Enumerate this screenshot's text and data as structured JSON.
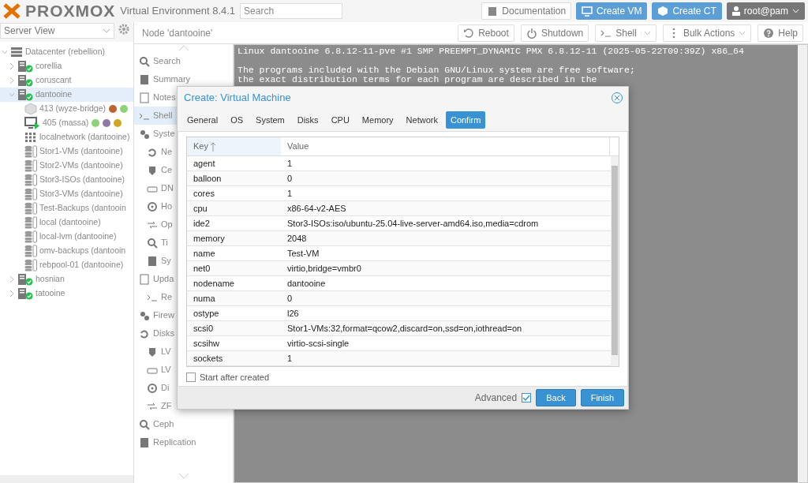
{
  "topbar": {
    "product": "PROXMOX",
    "version": "Virtual Environment 8.4.1",
    "search": {
      "placeholder": "Search"
    },
    "buttons": [
      {
        "label": "Documentation",
        "kind": "plain"
      },
      {
        "label": "Create VM",
        "kind": "primary"
      },
      {
        "label": "Create CT",
        "kind": "primary"
      }
    ],
    "user": "root@pam"
  },
  "sidebar": {
    "view": "Server View",
    "tree": [
      {
        "label": "Datacenter (rebellion)",
        "kind": "datacenter",
        "expanded": true,
        "selected": false,
        "children": [
          {
            "label": "corellia",
            "kind": "node",
            "expanded": false,
            "selected": false
          },
          {
            "label": "coruscant",
            "kind": "node",
            "expanded": false,
            "selected": false
          },
          {
            "label": "dantooine",
            "kind": "node",
            "expanded": true,
            "selected": true,
            "children": [
              {
                "label": "413 (wyze-bridge)",
                "kind": "ct",
                "selected": false,
                "tags": [
                  {
                    "color": "#c0622f"
                  },
                  {
                    "color": "#8fd378"
                  }
                ]
              },
              {
                "label": "405 (massa)",
                "kind": "vm",
                "selected": false,
                "tags": [
                  {
                    "color": "#8fd378"
                  },
                  {
                    "color": "#8f78a6"
                  },
                  {
                    "color": "#d3a622"
                  }
                ]
              },
              {
                "label": "localnetwork (dantooine)",
                "kind": "sdn",
                "selected": false
              },
              {
                "label": "Stor1-VMs (dantooine)",
                "kind": "storage",
                "selected": false
              },
              {
                "label": "Stor2-VMs (dantooine)",
                "kind": "storage",
                "selected": false
              },
              {
                "label": "Stor3-ISOs (dantooine)",
                "kind": "storage",
                "selected": false
              },
              {
                "label": "Stor3-VMs (dantooine)",
                "kind": "storage",
                "selected": false
              },
              {
                "label": "Test-Backups (dantooin",
                "kind": "storage",
                "selected": false
              },
              {
                "label": "local (dantooine)",
                "kind": "storage",
                "selected": false
              },
              {
                "label": "local-lvm (dantooine)",
                "kind": "storage",
                "selected": false
              },
              {
                "label": "omv-backups (dantooin",
                "kind": "storage",
                "selected": false
              },
              {
                "label": "rebpool-01 (dantooine)",
                "kind": "storage",
                "selected": false
              }
            ]
          },
          {
            "label": "hosnian",
            "kind": "node",
            "expanded": false,
            "selected": false
          },
          {
            "label": "tatooine",
            "kind": "node",
            "expanded": false,
            "selected": false
          }
        ]
      }
    ]
  },
  "node_panel": {
    "title": "Node 'dantooine'",
    "toolbar": [
      {
        "label": "Reboot",
        "kind": "plain"
      },
      {
        "label": "Shutdown",
        "kind": "plain"
      },
      {
        "label": "Shell",
        "kind": "split"
      },
      {
        "label": "Bulk Actions",
        "kind": "menu"
      },
      {
        "label": "Help",
        "kind": "plain"
      }
    ],
    "nav": [
      {
        "label": "Search",
        "selected": false
      },
      {
        "label": "Summary",
        "selected": false
      },
      {
        "label": "Notes",
        "selected": false
      },
      {
        "label": "Shell",
        "selected": true
      },
      {
        "label": "Syste",
        "selected": false,
        "children": [
          {
            "label": "Ne",
            "selected": false
          },
          {
            "label": "Ce",
            "selected": false
          },
          {
            "label": "DN",
            "selected": false
          },
          {
            "label": "Ho",
            "selected": false
          },
          {
            "label": "Op",
            "selected": false
          },
          {
            "label": "Ti",
            "selected": false
          },
          {
            "label": "Sy",
            "selected": false
          }
        ]
      },
      {
        "label": "Upda",
        "selected": false,
        "children": [
          {
            "label": "Re",
            "selected": false
          }
        ]
      },
      {
        "label": "Firew",
        "selected": false
      },
      {
        "label": "Disks",
        "selected": false,
        "children": [
          {
            "label": "LV",
            "selected": false
          },
          {
            "label": "LV",
            "selected": false
          },
          {
            "label": "Di",
            "selected": false
          },
          {
            "label": "ZF",
            "selected": false
          }
        ]
      },
      {
        "label": "Ceph",
        "selected": false
      },
      {
        "label": "Replication",
        "selected": false
      }
    ],
    "terminal": {
      "blocks": [
        [
          "Linux dantooine 6.8.12-11-pve #1 SMP PREEMPT_DYNAMIC PMX 6.8.12-11 (2025-05-22T09:39Z) x86_64"
        ],
        [
          "The programs included with the Debian GNU/Linux system are free software;",
          "the exact distribution terms for each program are described in the"
        ]
      ]
    }
  },
  "dialog": {
    "title": "Create: Virtual Machine",
    "tabs": [
      {
        "label": "General",
        "selected": false
      },
      {
        "label": "OS",
        "selected": false
      },
      {
        "label": "System",
        "selected": false
      },
      {
        "label": "Disks",
        "selected": false
      },
      {
        "label": "CPU",
        "selected": false
      },
      {
        "label": "Memory",
        "selected": false
      },
      {
        "label": "Network",
        "selected": false
      },
      {
        "label": "Confirm",
        "selected": true
      }
    ],
    "columns": [
      {
        "label": "Key",
        "sorted": true
      },
      {
        "label": "Value",
        "sorted": false
      }
    ],
    "rows": [
      {
        "key": "agent",
        "value": "1"
      },
      {
        "key": "balloon",
        "value": "0"
      },
      {
        "key": "cores",
        "value": "1"
      },
      {
        "key": "cpu",
        "value": "x86-64-v2-AES"
      },
      {
        "key": "ide2",
        "value": "Stor3-ISOs:iso/ubuntu-25.04-live-server-amd64.iso,media=cdrom"
      },
      {
        "key": "memory",
        "value": "2048"
      },
      {
        "key": "name",
        "value": "Test-VM"
      },
      {
        "key": "net0",
        "value": "virtio,bridge=vmbr0"
      },
      {
        "key": "nodename",
        "value": "dantooine"
      },
      {
        "key": "numa",
        "value": "0"
      },
      {
        "key": "ostype",
        "value": "l26"
      },
      {
        "key": "scsi0",
        "value": "Stor1-VMs:32,format=qcow2,discard=on,ssd=on,iothread=on"
      },
      {
        "key": "scsihw",
        "value": "virtio-scsi-single"
      },
      {
        "key": "sockets",
        "value": "1"
      }
    ],
    "start_after_created": {
      "label": "Start after created",
      "checked": false
    },
    "advanced": {
      "label": "Advanced",
      "checked": true
    },
    "buttons": [
      "Back",
      "Finish"
    ]
  }
}
